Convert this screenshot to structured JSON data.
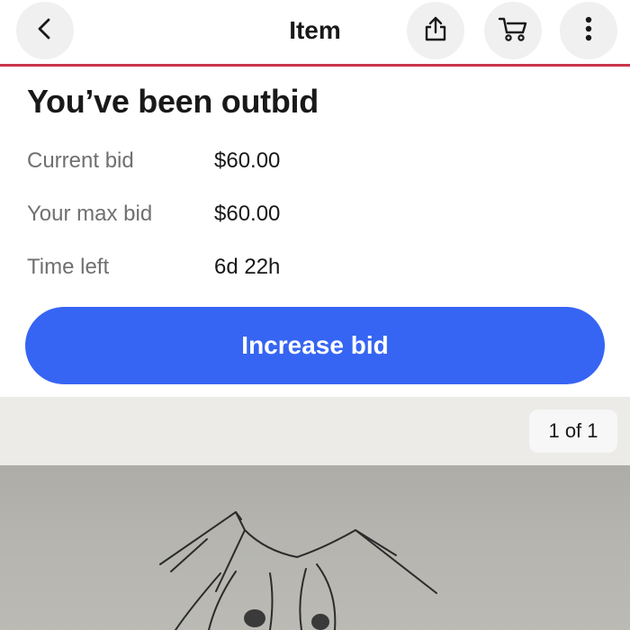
{
  "header": {
    "title": "Item",
    "back_icon": "chevron-left-icon",
    "share_icon": "share-icon",
    "cart_icon": "cart-icon",
    "more_icon": "more-vertical-icon",
    "divider_color": "#c9354b"
  },
  "status": {
    "heading": "You’ve been outbid"
  },
  "details": [
    {
      "label": "Current bid",
      "value": "$60.00"
    },
    {
      "label": "Your max bid",
      "value": "$60.00"
    },
    {
      "label": "Time left",
      "value": "6d 22h"
    }
  ],
  "action": {
    "label": "Increase bid",
    "color": "#3665f3"
  },
  "gallery": {
    "counter": "1 of 1"
  }
}
